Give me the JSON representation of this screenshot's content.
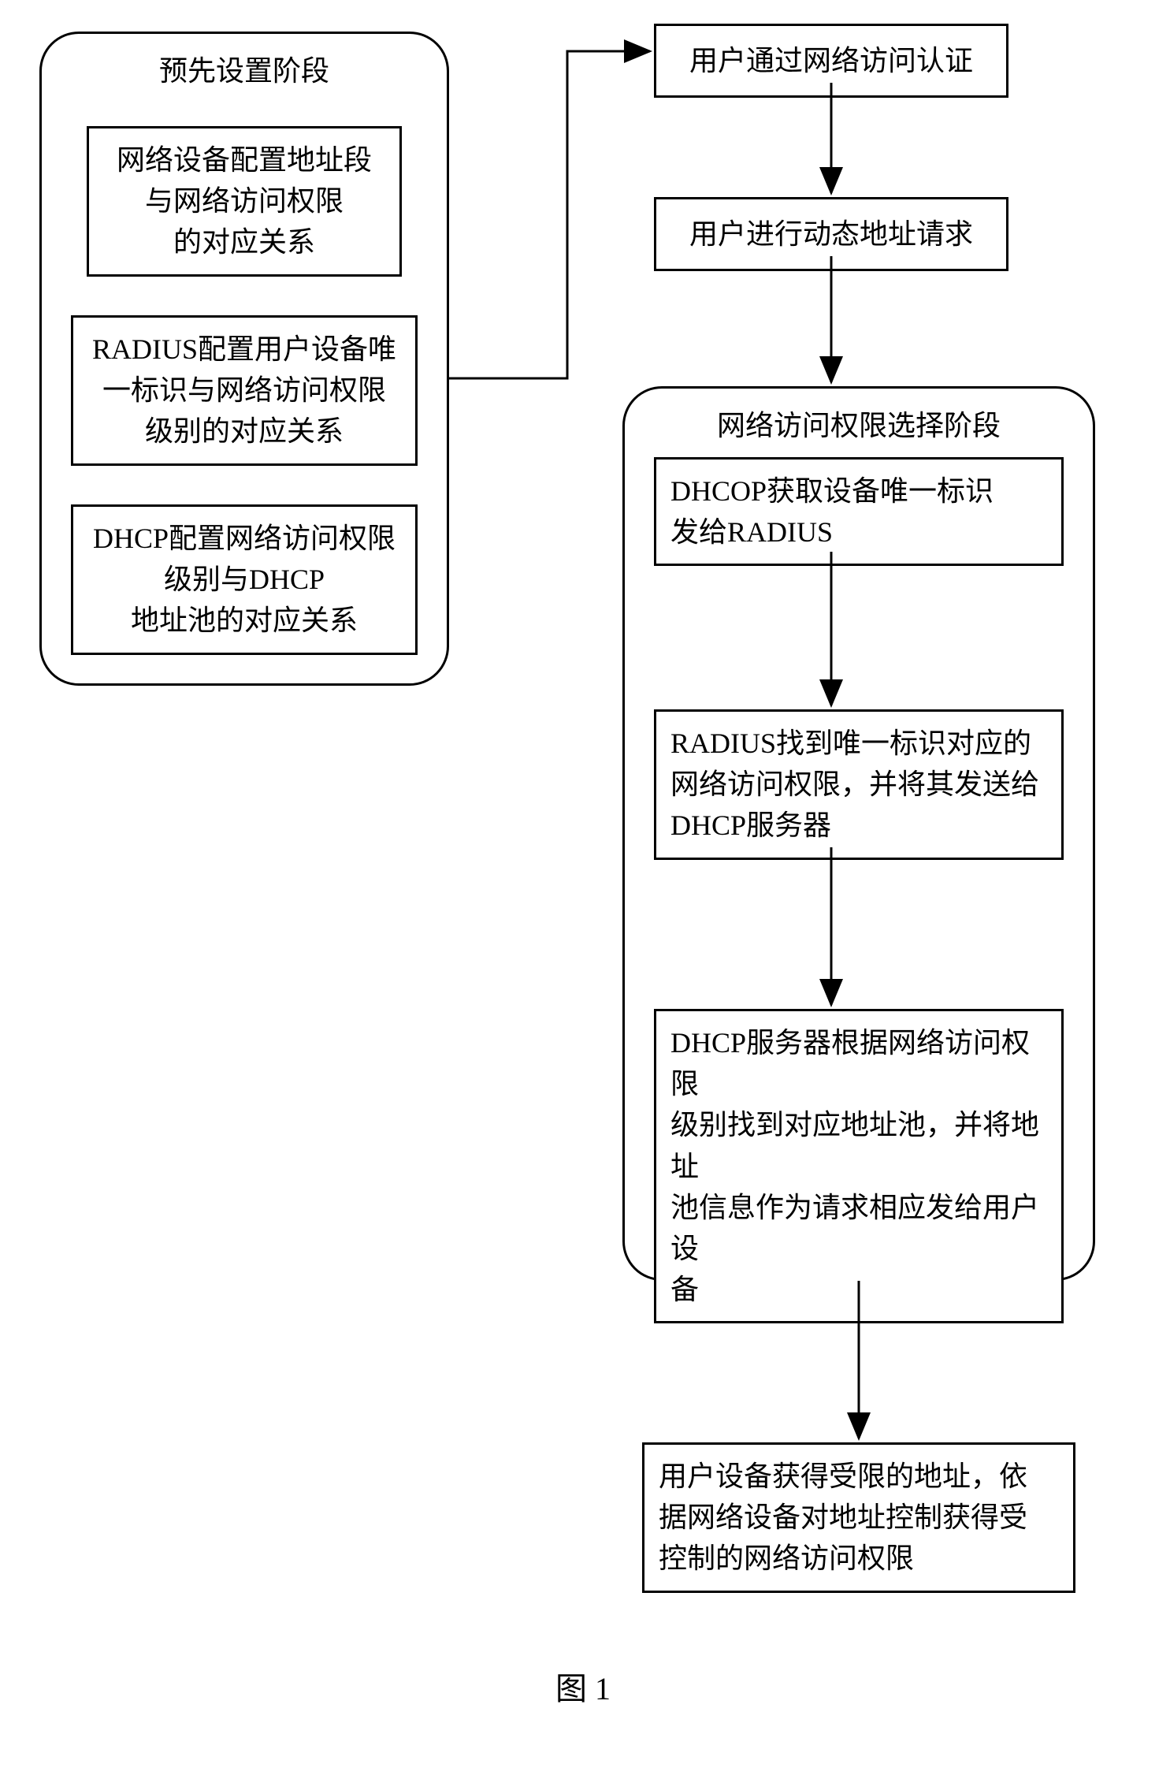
{
  "panels": {
    "left": {
      "title": "预先设置阶段"
    },
    "right": {
      "title": "网络访问权限选择阶段"
    }
  },
  "boxes": {
    "l1": "网络设备配置地址段\n与网络访问权限\n的对应关系",
    "l2": "RADIUS配置用户设备唯\n一标识与网络访问权限\n级别的对应关系",
    "l3": "DHCP配置网络访问权限\n级别与DHCP\n地址池的对应关系",
    "t1": "用户通过网络访问认证",
    "t2": "用户进行动态地址请求",
    "r1": "DHCOP获取设备唯一标识\n发给RADIUS",
    "r2": "RADIUS找到唯一标识对应的\n网络访问权限，并将其发送给\nDHCP服务器",
    "r3": "DHCP服务器根据网络访问权限\n级别找到对应地址池，并将地址\n池信息作为请求相应发给用户设\n备",
    "b1": "用户设备获得受限的地址，依\n据网络设备对地址控制获得受\n控制的网络访问权限"
  },
  "caption": "图 1"
}
